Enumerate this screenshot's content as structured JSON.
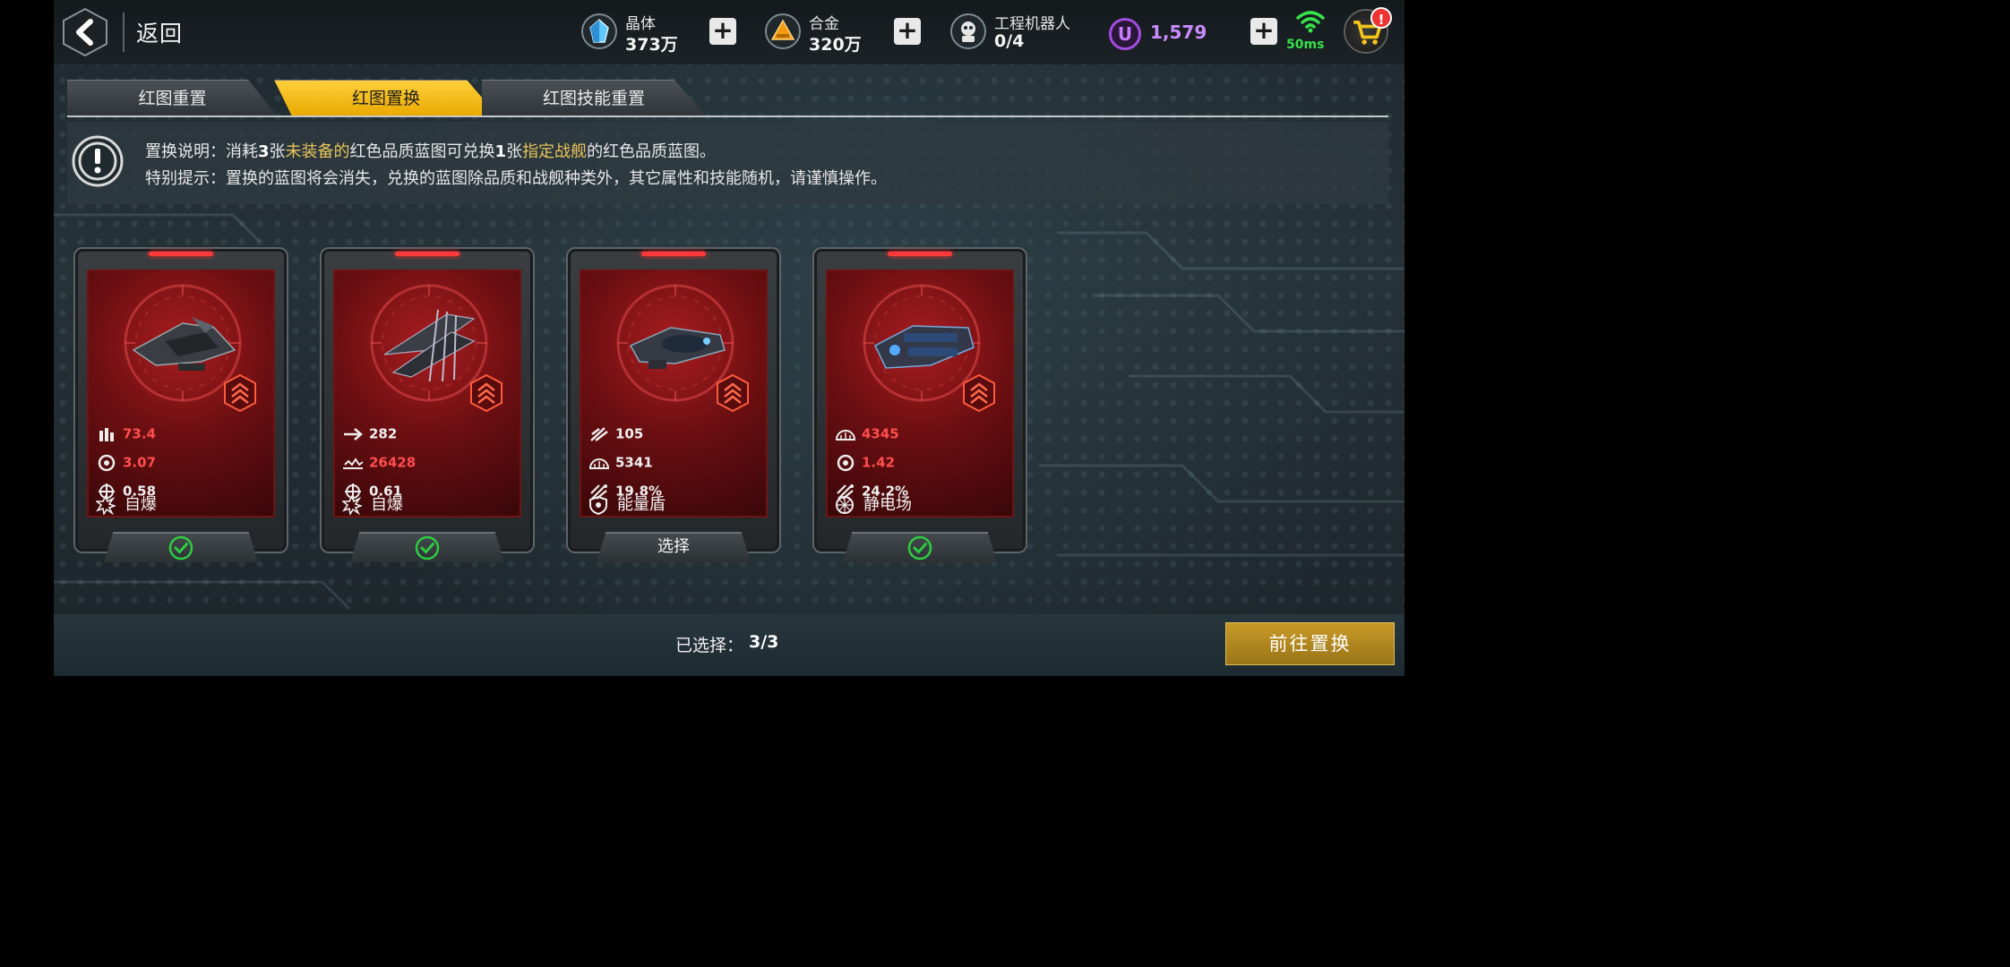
{
  "header": {
    "back_label": "返回",
    "resources": [
      {
        "name": "晶体",
        "value": "373万",
        "icon": "crystal-icon"
      },
      {
        "name": "合金",
        "value": "320万",
        "icon": "alloy-icon"
      },
      {
        "name": "工程机器人",
        "value": "0/4",
        "icon": "robot-icon"
      }
    ],
    "u_currency": {
      "badge": "U",
      "value": "1,579"
    },
    "ping": "50ms",
    "cart_badge": "!"
  },
  "tabs": [
    {
      "label": "红图重置",
      "active": false
    },
    {
      "label": "红图置换",
      "active": true
    },
    {
      "label": "红图技能重置",
      "active": false
    }
  ],
  "info": {
    "line1": {
      "p1": "置换说明：消耗",
      "n1": "3",
      "p2": "张",
      "hl1": "未装备的",
      "p3": "红色品质蓝图可兑换",
      "n2": "1",
      "p4": "张",
      "hl2": "指定战舰",
      "p5": "的红色品质蓝图。"
    },
    "line2": "特别提示：置换的蓝图将会消失，兑换的蓝图除品质和战舰种类外，其它属性和技能随机，请谨慎操作。"
  },
  "cards": [
    {
      "stats": [
        {
          "icon": "ammo-icon",
          "value": "73.4",
          "color": "red"
        },
        {
          "icon": "cooldown-icon",
          "value": "3.07",
          "color": "red"
        },
        {
          "icon": "crosshair-icon",
          "value": "0.58",
          "color": "white"
        }
      ],
      "skill": "自爆",
      "skill_icon": "explosion-icon",
      "footer": "",
      "selected": true
    },
    {
      "stats": [
        {
          "icon": "speed-arrow-icon",
          "value": "282",
          "color": "white"
        },
        {
          "icon": "hull-icon",
          "value": "26428",
          "color": "red"
        },
        {
          "icon": "crosshair-icon",
          "value": "0.61",
          "color": "white"
        }
      ],
      "skill": "自爆",
      "skill_icon": "explosion-icon",
      "footer": "",
      "selected": true
    },
    {
      "stats": [
        {
          "icon": "missile-icon",
          "value": "105",
          "color": "white"
        },
        {
          "icon": "armor-icon",
          "value": "5341",
          "color": "white"
        },
        {
          "icon": "evasion-icon",
          "value": "19.8%",
          "color": "white"
        }
      ],
      "skill": "能量盾",
      "skill_icon": "shield-icon",
      "footer": "选择",
      "selected": false
    },
    {
      "stats": [
        {
          "icon": "armor-icon",
          "value": "4345",
          "color": "red"
        },
        {
          "icon": "cooldown-icon",
          "value": "1.42",
          "color": "red"
        },
        {
          "icon": "evasion-icon",
          "value": "24.2%",
          "color": "white"
        }
      ],
      "skill": "静电场",
      "skill_icon": "static-field-icon",
      "footer": "",
      "selected": true
    }
  ],
  "bottom": {
    "selected_label": "已选择：",
    "selected_value": "3/3",
    "go_button": "前往置换"
  },
  "colors": {
    "accent_gold": "#e9a800",
    "stat_red": "#ff4e4e",
    "check_green": "#2ecc40",
    "u_purple": "#a24ee0"
  }
}
